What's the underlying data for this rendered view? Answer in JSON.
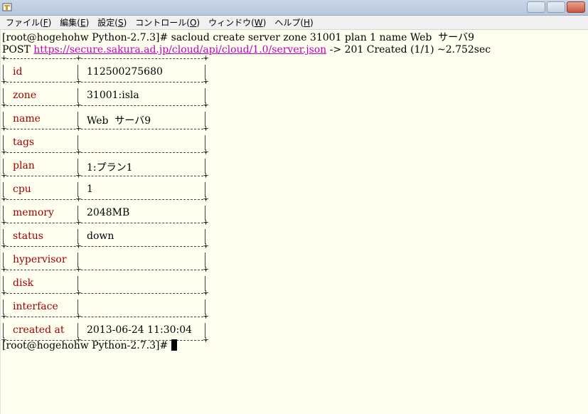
{
  "titlebar": {
    "title": ""
  },
  "menu": [
    {
      "label": "ファイル(",
      "acc": "F",
      "end": ")"
    },
    {
      "label": "編集(",
      "acc": "E",
      "end": ")"
    },
    {
      "label": "設定(",
      "acc": "S",
      "end": ")"
    },
    {
      "label": "コントロール(",
      "acc": "O",
      "end": ")"
    },
    {
      "label": "ウィンドウ(",
      "acc": "W",
      "end": ")"
    },
    {
      "label": "ヘルプ(",
      "acc": "H",
      "end": ")"
    }
  ],
  "terminal": {
    "command_line": "[root@hogehohw Python-2.7.3]# sacloud create server zone 31001 plan 1 name Web  サーバ9",
    "post_prefix": "POST ",
    "post_url": "https://secure.sakura.ad.jp/cloud/api/cloud/1.0/server.json",
    "post_suffix": " -> 201 Created (1/1) ~2.752sec",
    "rows": [
      {
        "key": "id",
        "value": "112500275680"
      },
      {
        "key": "zone",
        "value": "31001:isla"
      },
      {
        "key": "name",
        "value": "Web  サーバ9"
      },
      {
        "key": "tags",
        "value": ""
      },
      {
        "key": "plan",
        "value": "1:プラン1"
      },
      {
        "key": "cpu",
        "value": "1"
      },
      {
        "key": "memory",
        "value": "2048MB"
      },
      {
        "key": "status",
        "value": "down"
      },
      {
        "key": "hypervisor",
        "value": ""
      },
      {
        "key": "disk",
        "value": ""
      },
      {
        "key": "interface",
        "value": ""
      },
      {
        "key": "created at",
        "value": "2013-06-24 11:30:04"
      }
    ],
    "prompt": "[root@hogehohw Python-2.7.3]# "
  },
  "colors": {
    "key_color": "#a00000",
    "link_color": "#c000c0",
    "background": "#fffff0"
  }
}
